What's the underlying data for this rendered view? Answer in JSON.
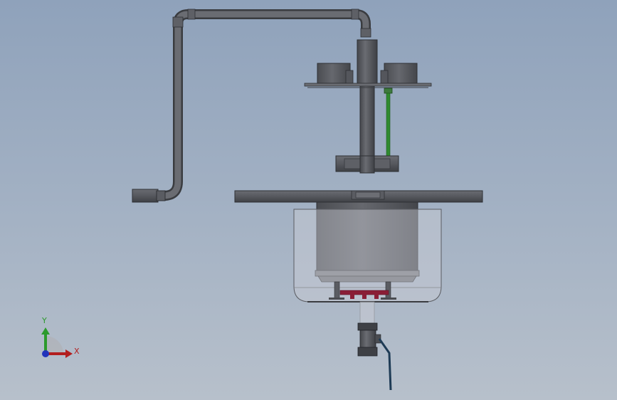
{
  "triad": {
    "y_label": "Y",
    "x_label": "X",
    "y_color": "#2c9a2c",
    "x_color": "#b21e1e",
    "z_color": "#2233bb"
  },
  "colors": {
    "background_top": "#8fa2bb",
    "background_bottom": "#b7c0cb",
    "steel": "#5a5c62",
    "steel_dark": "#3c3e42",
    "glass": "#c9ccd4",
    "green_rod": "#2f8a2f",
    "red_manifold": "#8a1e36",
    "valve_handle": "#1e3b55"
  }
}
